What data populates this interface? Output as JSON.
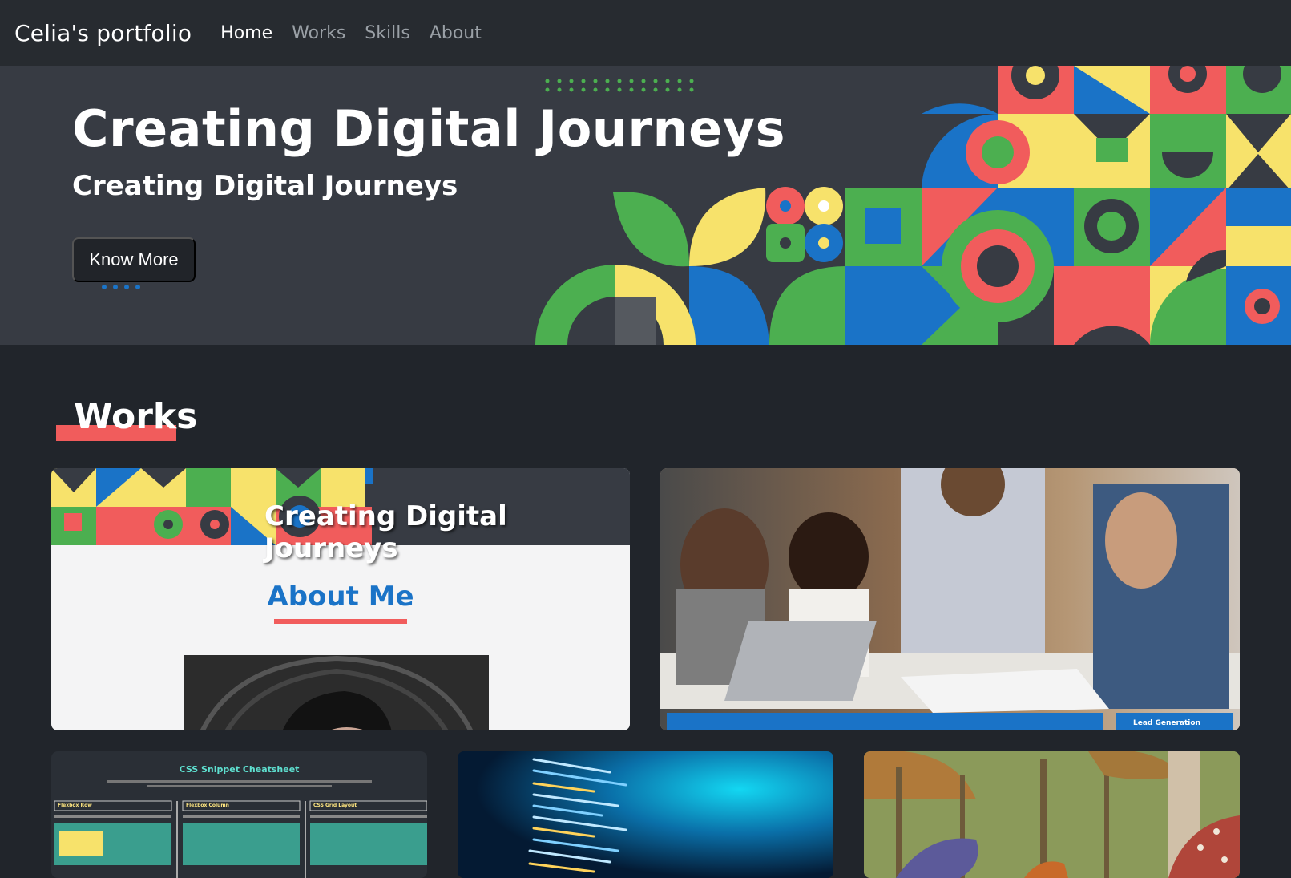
{
  "nav": {
    "brand": "Celia's portfolio",
    "items": [
      {
        "label": "Home",
        "active": true
      },
      {
        "label": "Works",
        "active": false
      },
      {
        "label": "Skills",
        "active": false
      },
      {
        "label": "About",
        "active": false
      }
    ]
  },
  "hero": {
    "title": "Creating Digital Journeys",
    "subtitle": "Creating Digital Journeys",
    "button_label": "Know More"
  },
  "works": {
    "heading": "Works",
    "cards": [
      {
        "banner_text": "Creating Digital Journeys",
        "heading": "About Me"
      },
      {
        "bar_label": "Lead Generation"
      },
      {
        "title": "CSS Snippet Cheatsheet",
        "columns": [
          "Flexbox Row",
          "Flexbox Column",
          "CSS Grid Layout"
        ]
      },
      {},
      {}
    ]
  },
  "colors": {
    "nav_bg": "#272b30",
    "hero_bg": "#373b43",
    "page_bg": "#21252b",
    "accent_red": "#f15c5c",
    "accent_green": "#4caf50",
    "accent_yellow": "#f7e26b",
    "accent_blue": "#1a73c7"
  }
}
